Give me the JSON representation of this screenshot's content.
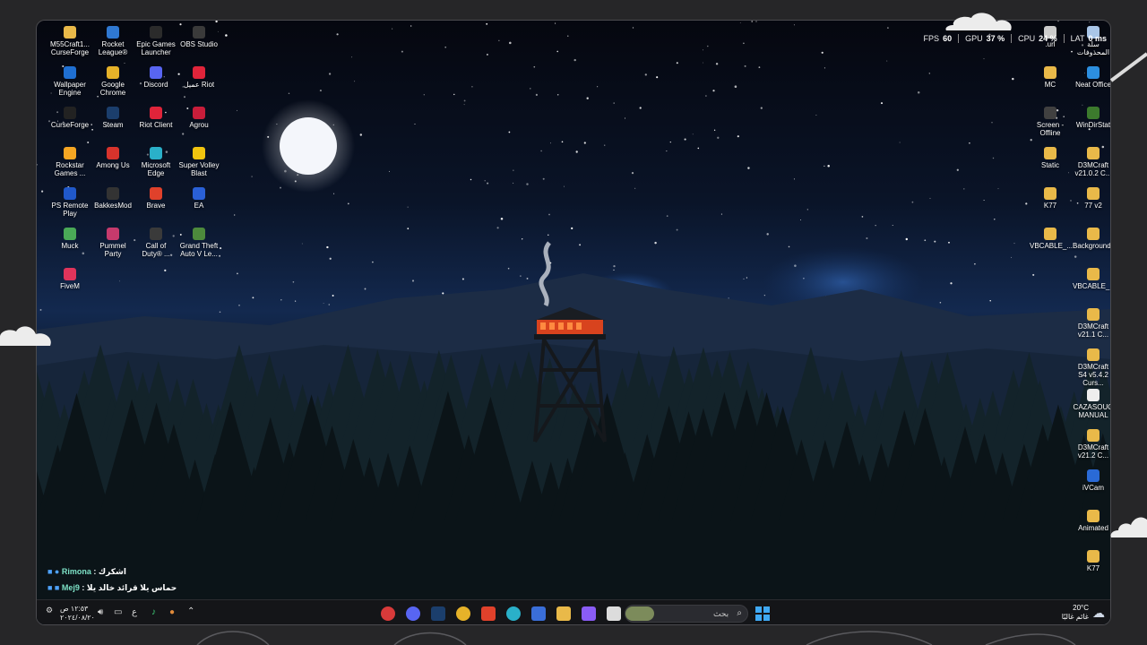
{
  "colors": {
    "accent": "#1f6fd1",
    "brave": "#e0412b",
    "chat_name": "#7ee3c8"
  },
  "hud": {
    "fps_label": "FPS",
    "fps_value": "60",
    "gpu_label": "GPU",
    "gpu_value": "37 %",
    "cpu_label": "CPU",
    "cpu_value": "24 %",
    "lat_label": "LAT",
    "lat_value": "0 ms"
  },
  "desktop_left": [
    {
      "label": "M55Craft1... CurseForge",
      "icon": "folder-icon"
    },
    {
      "label": "Rocket League®",
      "icon": "rocket-league-icon"
    },
    {
      "label": "Epic Games Launcher",
      "icon": "epic-games-icon"
    },
    {
      "label": "OBS Studio",
      "icon": "obs-icon"
    },
    {
      "label": "Wallpaper Engine",
      "icon": "wallpaper-engine-icon"
    },
    {
      "label": "Google Chrome",
      "icon": "chrome-icon"
    },
    {
      "label": "Discord",
      "icon": "discord-icon"
    },
    {
      "label": "عميل Riot",
      "icon": "riot-icon"
    },
    {
      "label": "CurseForge",
      "icon": "curseforge-icon"
    },
    {
      "label": "Steam",
      "icon": "steam-icon"
    },
    {
      "label": "Riot Client",
      "icon": "riot-icon"
    },
    {
      "label": "Agrou",
      "icon": "agrou-icon"
    },
    {
      "label": "Rockstar Games ...",
      "icon": "rockstar-icon"
    },
    {
      "label": "Among Us",
      "icon": "among-us-icon"
    },
    {
      "label": "Microsoft Edge",
      "icon": "edge-icon"
    },
    {
      "label": "Super Volley Blast",
      "icon": "volley-icon"
    },
    {
      "label": "PS Remote Play",
      "icon": "ps-remote-icon"
    },
    {
      "label": "BakkesMod",
      "icon": "bakkesmod-icon"
    },
    {
      "label": "Brave",
      "icon": "brave-icon"
    },
    {
      "label": "EA",
      "icon": "ea-icon"
    },
    {
      "label": "Muck",
      "icon": "muck-icon"
    },
    {
      "label": "Pummel Party",
      "icon": "pummel-icon"
    },
    {
      "label": "Call of Duty® ...",
      "icon": "cod-icon"
    },
    {
      "label": "Grand Theft Auto V Le...",
      "icon": "gta-icon"
    },
    {
      "label": "FiveM",
      "icon": "fivem-icon"
    }
  ],
  "desktop_right": [
    {
      "label": "سلة المحذوفات",
      "icon": "recycle-bin-icon"
    },
    {
      "label": ".url",
      "icon": "url-icon"
    },
    {
      "label": "MC",
      "icon": "folder-icon"
    },
    {
      "label": "Neat Office",
      "icon": "neat-office-icon"
    },
    {
      "label": "Screen - Offline",
      "icon": "screen-icon"
    },
    {
      "label": "WinDirStat",
      "icon": "windirstat-icon"
    },
    {
      "label": "Static",
      "icon": "folder-icon"
    },
    {
      "label": "D3MCraft v21.0.2 C...",
      "icon": "folder-icon"
    },
    {
      "label": "K77",
      "icon": "folder-icon"
    },
    {
      "label": "77 v2",
      "icon": "folder-icon"
    },
    {
      "label": "VBCABLE_...",
      "icon": "folder-icon"
    },
    {
      "label": "Backgrounds",
      "icon": "folder-icon"
    },
    {
      "label": "VBCABLE_...",
      "icon": "folder-icon"
    },
    {
      "label": "D3MCraft v21.1 C...",
      "icon": "folder-icon"
    },
    {
      "label": "D3MCraft S4 v5.4.2 Curs...",
      "icon": "folder-icon"
    },
    {
      "label": "CAZASOUQ MANUAL",
      "icon": "document-icon"
    },
    {
      "label": "D3MCraft v21.2 C...",
      "icon": "folder-icon"
    },
    {
      "label": "iVCam",
      "icon": "ivcam-icon"
    },
    {
      "label": "Animated",
      "icon": "folder-icon"
    },
    {
      "label": "K77",
      "icon": "folder-icon"
    }
  ],
  "chat": [
    {
      "name": "Rimona",
      "message": ": اشكرك"
    },
    {
      "name": "Mej9",
      "message": ": حماس يلا قرائد خالد يلا"
    }
  ],
  "taskbar": {
    "search_placeholder": "بحث",
    "weather_temp": "20°C",
    "weather_desc": "غائم غالبًا",
    "clock_time": "١٢:٥٣ ص",
    "clock_date": "٢٠٢٤/٠٨/٢٠",
    "lang": "ع",
    "apps": [
      "clock-icon",
      "discord-icon",
      "steam-icon",
      "chrome-icon",
      "brave-icon",
      "edge-icon",
      "store-icon",
      "file-explorer-icon",
      "copilot-icon",
      "taskview-icon"
    ]
  }
}
